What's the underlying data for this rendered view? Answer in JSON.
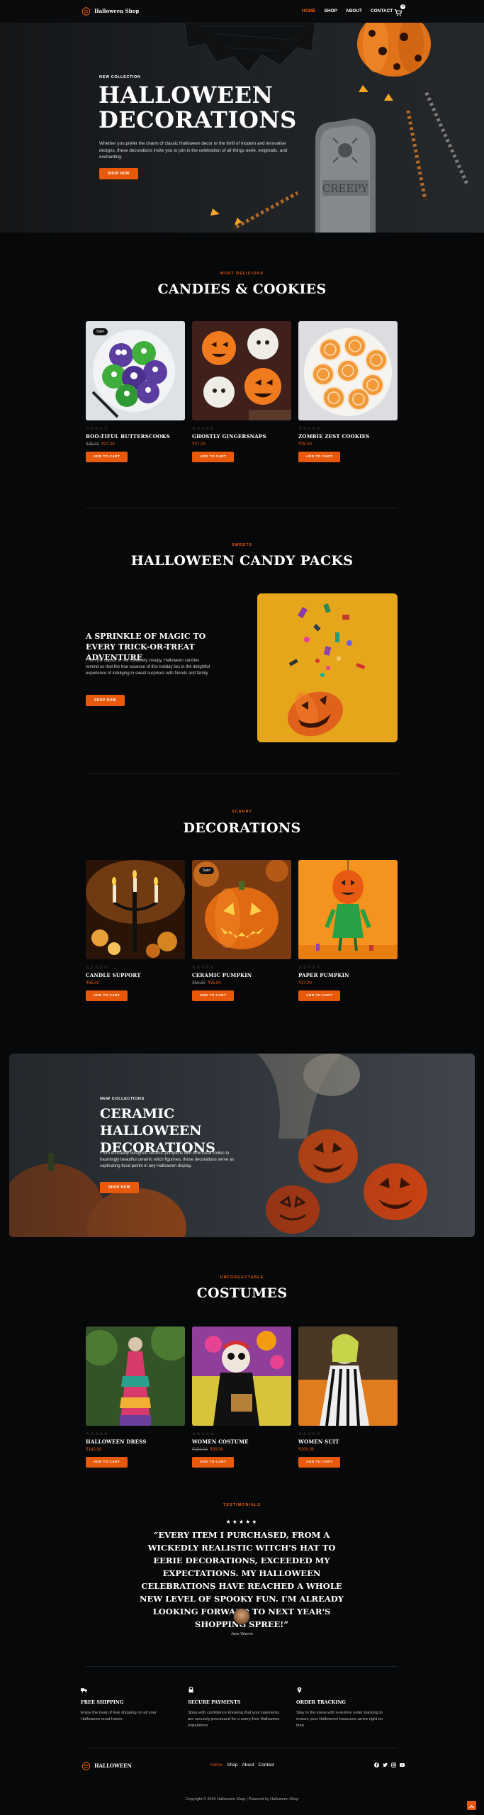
{
  "colors": {
    "accent": "#e8590c",
    "background": "#070809",
    "text": "#ffffff"
  },
  "header": {
    "logo_text": "Halloween Shop",
    "nav": [
      "HOME",
      "SHOP",
      "ABOUT",
      "CONTACT"
    ],
    "cart_count": "0"
  },
  "hero": {
    "eyebrow": "NEW COLLECTION",
    "title": "HALLOWEEN DECORATIONS",
    "description": "Whether you prefer the charm of classic Halloween decor or the thrill of modern and innovative designs, these decorations invite you to join in the celebration of all things eerie, enigmatic, and enchanting.",
    "button": "SHOP NOW",
    "tombstone_text": "CREEPY"
  },
  "candies": {
    "eyebrow": "MOST DELICIOUS",
    "title": "CANDIES & COOKIES",
    "products": [
      {
        "name": "BOO-TIFUL BUTTERSCOOKS",
        "old_price": "₹35.00",
        "price": "₹27.00",
        "sale": "Sale!",
        "stars": "☆☆☆☆☆",
        "button": "ADD TO CART"
      },
      {
        "name": "GHOSTLY GINGERSNAPS",
        "old_price": "",
        "price": "₹27.00",
        "sale": "",
        "stars": "☆☆☆☆☆",
        "button": "ADD TO CART"
      },
      {
        "name": "ZOMBIE ZEST COOKIES",
        "old_price": "",
        "price": "₹35.00",
        "sale": "",
        "stars": "☆☆☆☆☆",
        "button": "ADD TO CART"
      }
    ]
  },
  "candy_packs": {
    "eyebrow": "SWEETS",
    "title": "HALLOWEEN CANDY PACKS",
    "subtitle": "A SPRINKLE OF MAGIC TO EVERY TRICK-OR-TREAT ADVENTURE",
    "description": "From the classic to the creatively creepy, Halloween candies remind us that the true essence of this holiday lies in the delightful experience of indulging in sweet surprises with friends and family.",
    "button": "SHOP NOW"
  },
  "decorations": {
    "eyebrow": "SCARRY",
    "title": "DECORATIONS",
    "products": [
      {
        "name": "CANDLE SUPPORT",
        "old_price": "",
        "price": "₹65.00",
        "sale": "",
        "stars": "☆☆☆☆☆",
        "button": "ADD TO CART"
      },
      {
        "name": "CERAMIC PUMPKIN",
        "old_price": "₹50.00",
        "price": "₹35.00",
        "sale": "Sale!",
        "stars": "☆☆☆☆☆",
        "button": "ADD TO CART"
      },
      {
        "name": "PAPER PUMPKIN",
        "old_price": "",
        "price": "₹17.00",
        "sale": "",
        "stars": "☆☆☆☆☆",
        "button": "ADD TO CART"
      }
    ]
  },
  "ceramic_banner": {
    "eyebrow": "NEW COLLECTIONS",
    "title": "CERAMIC HALLOWEEN DECORATIONS",
    "description": "From intricately designed ceramic pumpkins with whimsical smiles to hauntingly beautiful ceramic witch figurines, these decorations serve as captivating focal points in any Halloween display.",
    "button": "SHOP NOW"
  },
  "costumes": {
    "eyebrow": "UNFORGETTABLE",
    "title": "COSTUMES",
    "products": [
      {
        "name": "HALLOWEEN DRESS",
        "old_price": "",
        "price": "₹145.00",
        "sale": "",
        "stars": "☆☆☆☆☆",
        "button": "ADD TO CART"
      },
      {
        "name": "WOMEN COSTUME",
        "old_price": "₹150.00",
        "price": "₹99.00",
        "sale": "",
        "stars": "☆☆☆☆☆",
        "button": "ADD TO CART"
      },
      {
        "name": "WOMEN SUIT",
        "old_price": "",
        "price": "₹100.00",
        "sale": "",
        "stars": "☆☆☆☆☆",
        "button": "ADD TO CART"
      }
    ]
  },
  "testimonial": {
    "eyebrow": "TESTIMONIALS",
    "stars": "★★★★★",
    "quote": "“EVERY ITEM I PURCHASED, FROM A WICKEDLY REALISTIC WITCH'S HAT TO EERIE DECORATIONS, EXCEEDED MY EXPECTATIONS. MY HALLOWEEN CELEBRATIONS HAVE REACHED A WHOLE NEW LEVEL OF SPOOKY FUN. I'M ALREADY LOOKING FORWARD TO NEXT YEAR'S SHOPPING SPREE!”",
    "name": "Jane Warren"
  },
  "features": [
    {
      "icon": "truck-icon",
      "title": "FREE SHIPPING",
      "desc": "Enjoy the treat of free shipping on all your Halloween must-haves"
    },
    {
      "icon": "lock-icon",
      "title": "SECURE PAYMENTS",
      "desc": "Shop with confidence knowing that your payments are securely processed for a worry-free Halloween experience"
    },
    {
      "icon": "location-pin-icon",
      "title": "ORDER TRACKING",
      "desc": "Stay in the know with real-time order tracking to ensure your Halloween treasures arrive right on time"
    }
  ],
  "footer": {
    "logo_text": "HALLOWEEN",
    "nav": [
      "Home",
      "Shop",
      "About",
      "Contact"
    ],
    "social": [
      "facebook-icon",
      "twitter-icon",
      "instagram-icon",
      "youtube-icon"
    ],
    "copyright": "Copyright © 2024 Halloween Shop | Powered by Halloween Shop"
  }
}
